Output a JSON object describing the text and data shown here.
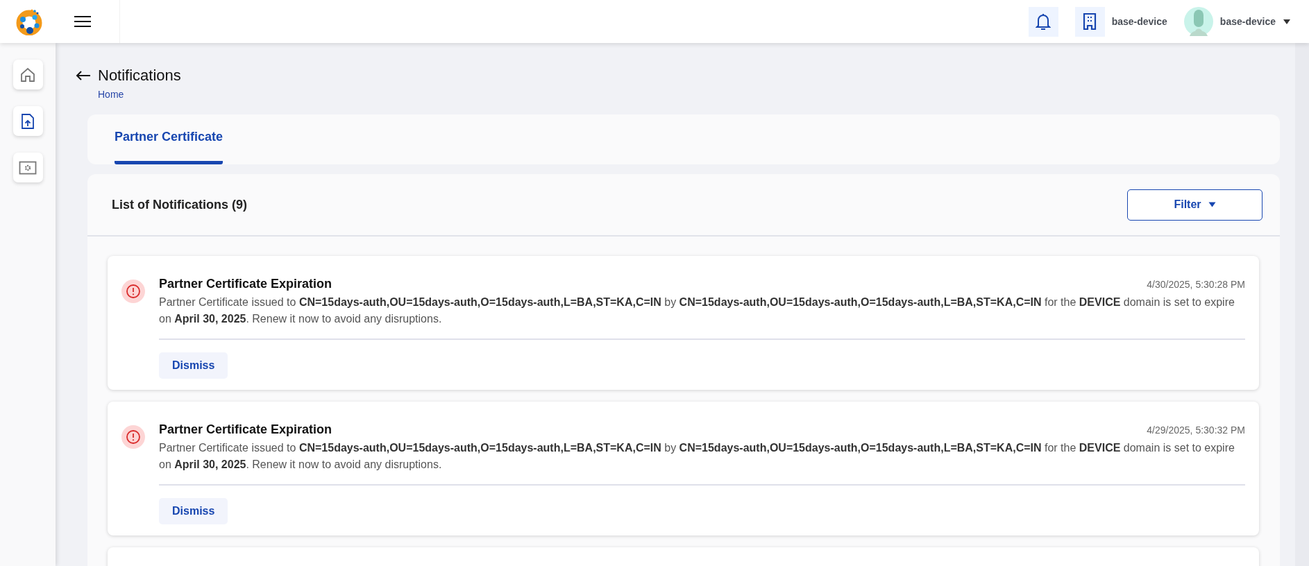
{
  "header": {
    "organization": "base-device",
    "user": "base-device"
  },
  "sidebar": {
    "items": [
      {
        "kind": "home",
        "selected": false
      },
      {
        "kind": "upload",
        "selected": true
      },
      {
        "kind": "settings",
        "selected": false
      }
    ]
  },
  "page": {
    "title": "Notifications",
    "breadcrumb": "Home"
  },
  "tabs": [
    {
      "label": "Partner Certificate",
      "selected": true
    }
  ],
  "list": {
    "title": "List of Notifications (9)",
    "filter": "Filter",
    "notifications": [
      {
        "kind": "error",
        "title": "Partner Certificate Expiration",
        "time": "4/30/2025, 5:30:28 PM",
        "message": "Partner Certificate issued to **CN=15days-auth,OU=15days-auth,O=15days-auth,L=BA,ST=KA,C=IN** by **CN=15days-auth,OU=15days-auth,O=15days-auth,L=BA,ST=KA,C=IN** for the **DEVICE** domain is set to expire on **April 30, 2025**. Renew it now to avoid any disruptions.",
        "action": "Dismiss"
      },
      {
        "kind": "error",
        "title": "Partner Certificate Expiration",
        "time": "4/29/2025, 5:30:32 PM",
        "message": "Partner Certificate issued to **CN=15days-auth,OU=15days-auth,O=15days-auth,L=BA,ST=KA,C=IN** by **CN=15days-auth,OU=15days-auth,O=15days-auth,L=BA,ST=KA,C=IN** for the **DEVICE** domain is set to expire on **April 30, 2025**. Renew it now to avoid any disruptions.",
        "action": "Dismiss"
      }
    ]
  }
}
